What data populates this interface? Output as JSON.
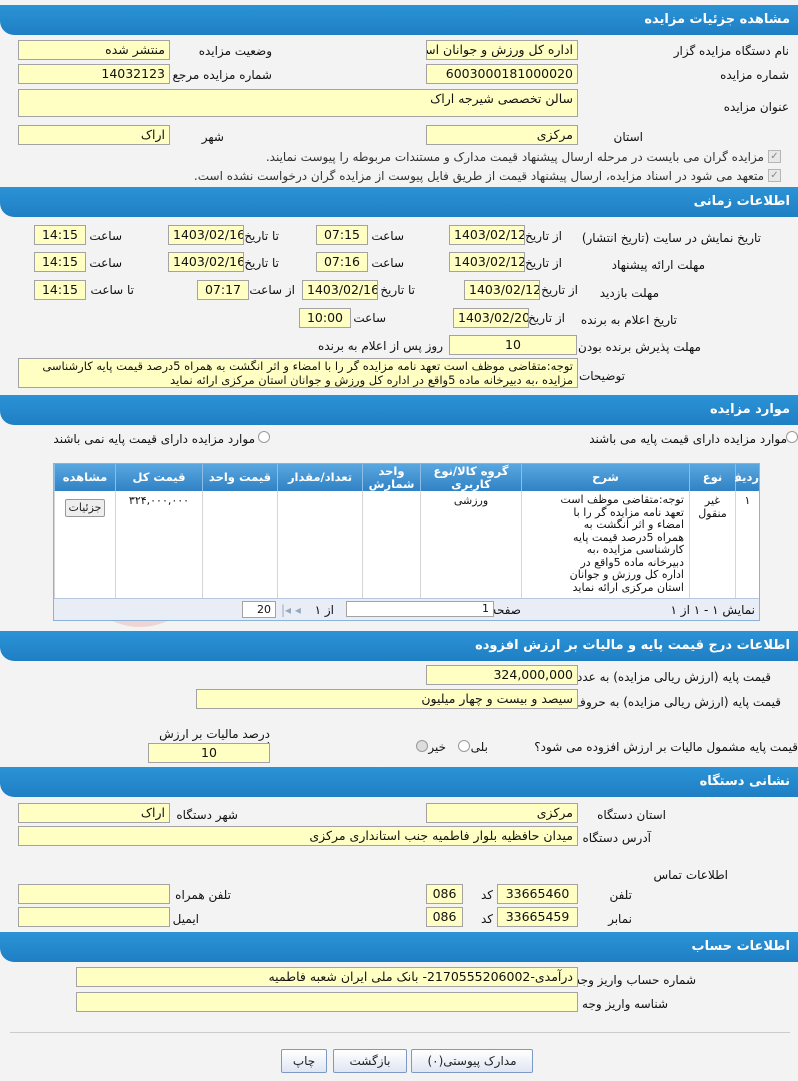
{
  "sections": {
    "details": "مشاهده جزئیات مزایده",
    "timing": "اطلاعات زمانی",
    "items": "موارد مزایده",
    "price": "اطلاعات درج قیمت پایه و مالیات بر ارزش افزوده",
    "address": "نشانی دستگاه",
    "account": "اطلاعات حساب"
  },
  "details": {
    "org_label": "نام دستگاه مزایده گزار",
    "org": "اداره کل ورزش و جوانان است",
    "status_label": "وضعیت مزایده",
    "status": "منتشر شده",
    "number_label": "شماره مزایده",
    "number": "6003000181000020",
    "ref_label": "شماره مزایده مرجع",
    "ref": "14032123",
    "title_label": "عنوان مزایده",
    "title": "سالن تخصصی شیرجه اراک",
    "province_label": "استان",
    "province": "مرکزی",
    "city_label": "شهر",
    "city": "اراک",
    "check1": "مزایده گران می بایست در مرحله ارسال پیشنهاد قیمت مدارک و مستندات مربوطه را پیوست نمایند.",
    "check2": "متعهد می شود در اسناد مزایده، ارسال پیشنهاد قیمت از طریق فایل پیوست از مزایده گران درخواست نشده است."
  },
  "timing": {
    "r1_label": "تاریخ نمایش در سایت (تاریخ انتشار)",
    "r2_label": "مهلت ارائه پیشنهاد",
    "r3_label": "مهلت بازدید",
    "r4_label": "تاریخ اعلام به برنده",
    "r5_label": "مهلت پذیرش برنده بودن",
    "from_date": "از تاریخ",
    "to_date": "تا تاریخ",
    "time": "ساعت",
    "from_time": "از ساعت",
    "to_time": "تا ساعت",
    "r1_from": "1403/02/12",
    "r1_from_time": "07:15",
    "r1_to": "1403/02/16",
    "r1_to_time": "14:15",
    "r2_from": "1403/02/12",
    "r2_from_time": "07:16",
    "r2_to": "1403/02/16",
    "r2_to_time": "14:15",
    "r3_from": "1403/02/12",
    "r3_to": "1403/02/16",
    "r3_from_time": "07:17",
    "r3_to_time": "14:15",
    "r4_from": "1403/02/20",
    "r4_time": "10:00",
    "r5_days": "10",
    "r5_suffix": "روز پس از اعلام به برنده",
    "desc_label": "توضیحات",
    "desc": "توجه:متقاضی موظف است تعهد نامه مزایده گر را با  امضاء و اثر انگشت به همراه  5درصد  قیمت پایه کارشناسی مزایده ،به دبیرخانه ماده 5واقع در اداره کل ورزش و جوانان استان مرکزی ارائه نماید"
  },
  "items": {
    "opt_with": "موارد مزایده دارای قیمت پایه می باشند",
    "opt_without": "موارد مزایده دارای قیمت پایه نمی باشند",
    "headers": [
      "ردیف",
      "نوع",
      "شرح",
      "گروه کالا/نوع کاربری",
      "واحد شمارش",
      "تعداد/مقدار",
      "قیمت واحد",
      "قیمت کل",
      "مشاهده"
    ],
    "row": {
      "idx": "۱",
      "type": "غیر منقول",
      "desc": "توجه:متقاضی موظف است تعهد نامه مزایده گر را با  امضاء و اثر انگشت به همراه  5درصد  قیمت پایه کارشناسی مزایده ،به دبیرخانه ماده 5واقع در اداره کل ورزش و جوانان استان مرکزی ارائه نماید",
      "group": "ورزشی",
      "unit": "",
      "qty": "",
      "unit_price": "",
      "total": "۳۲۴,۰۰۰,۰۰۰",
      "view_btn": "جزئیات"
    },
    "pager": {
      "display": "نمایش ۱ - ۱ از ۱",
      "page_label": "صفحه",
      "page": "1",
      "of": "از ۱",
      "per_page": "20"
    }
  },
  "watermark": "AriaTender",
  "price": {
    "base_num_label": "قیمت پایه (ارزش ریالی مزایده) به عدد",
    "base_num": "324,000,000",
    "base_word_label": "قیمت پایه (ارزش ریالی مزایده) به حروف",
    "base_word": "سیصد و بیست و چهار میلیون",
    "vat_q": "قیمت پایه مشمول مالیات بر ارزش افزوده می شود؟",
    "yes": "بلی",
    "no": "خیر",
    "vat_pct_label": "درصد مالیات بر ارزش افزوده",
    "vat_pct": "10"
  },
  "address": {
    "province_label": "استان دستگاه",
    "province": "مرکزی",
    "city_label": "شهر دستگاه",
    "city": "اراک",
    "addr_label": "آدرس دستگاه",
    "addr": "میدان حافظیه بلوار فاطمیه جنب استانداری مرکزی",
    "contact": "اطلاعات تماس",
    "phone_label": "تلفن",
    "phone": "33665460",
    "phone_code": "086",
    "code_label": "کد",
    "fax_label": "نمابر",
    "fax": "33665459",
    "fax_code": "086",
    "mobile_label": "تلفن همراه",
    "email_label": "ایمیل"
  },
  "account": {
    "acc_label": "شماره حساب واریز وجه",
    "acc": "درآمدی-2170555206002- بانک ملی ایران شعبه فاطمیه",
    "id_label": "شناسه واریز وجه"
  },
  "buttons": {
    "docs": "مدارک پیوستی(۰)",
    "back": "بازگشت",
    "print": "چاپ"
  }
}
